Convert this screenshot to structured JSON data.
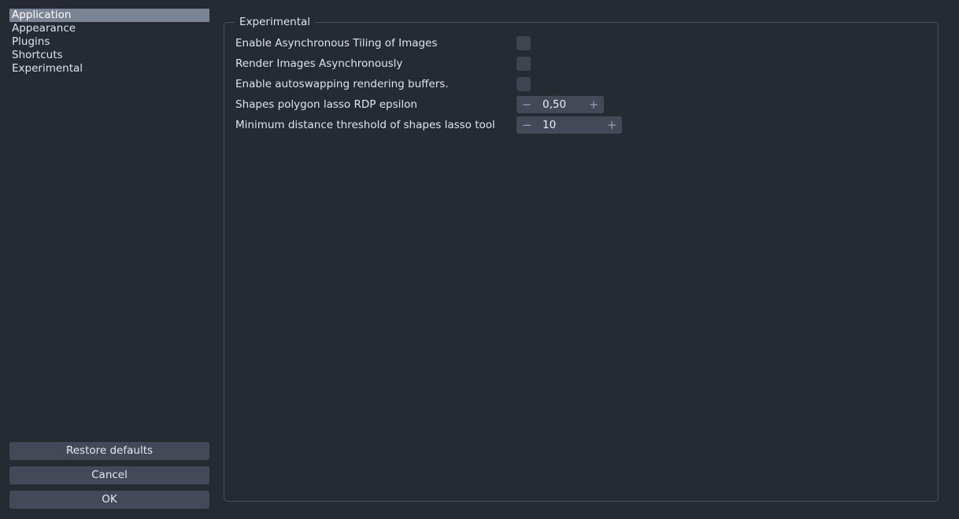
{
  "sidebar": {
    "categories": [
      {
        "label": "Application",
        "selected": true
      },
      {
        "label": "Appearance",
        "selected": false
      },
      {
        "label": "Plugins",
        "selected": false
      },
      {
        "label": "Shortcuts",
        "selected": false
      },
      {
        "label": "Experimental",
        "selected": false
      }
    ],
    "buttons": {
      "restore_defaults": "Restore defaults",
      "cancel": "Cancel",
      "ok": "OK"
    }
  },
  "panel": {
    "group_title": "Experimental",
    "rows": [
      {
        "label": "Enable Asynchronous Tiling of Images",
        "control": "checkbox",
        "checked": false
      },
      {
        "label": "Render Images Asynchronously",
        "control": "checkbox",
        "checked": false
      },
      {
        "label": "Enable autoswapping rendering buffers.",
        "control": "checkbox",
        "checked": false
      },
      {
        "label": "Shapes polygon lasso RDP epsilon",
        "control": "spinbox",
        "value": "0,50",
        "decrement": "−",
        "increment": "+",
        "width": "narrow"
      },
      {
        "label": "Minimum distance threshold of shapes lasso tool",
        "control": "spinbox",
        "value": "10",
        "decrement": "−",
        "increment": "+",
        "width": "wide"
      }
    ]
  },
  "colors": {
    "background": "#262a33",
    "selection": "#7b8494",
    "button": "#434956",
    "checkbox": "#3e4450",
    "border": "#4a505d",
    "text": "#dfe4ee"
  }
}
